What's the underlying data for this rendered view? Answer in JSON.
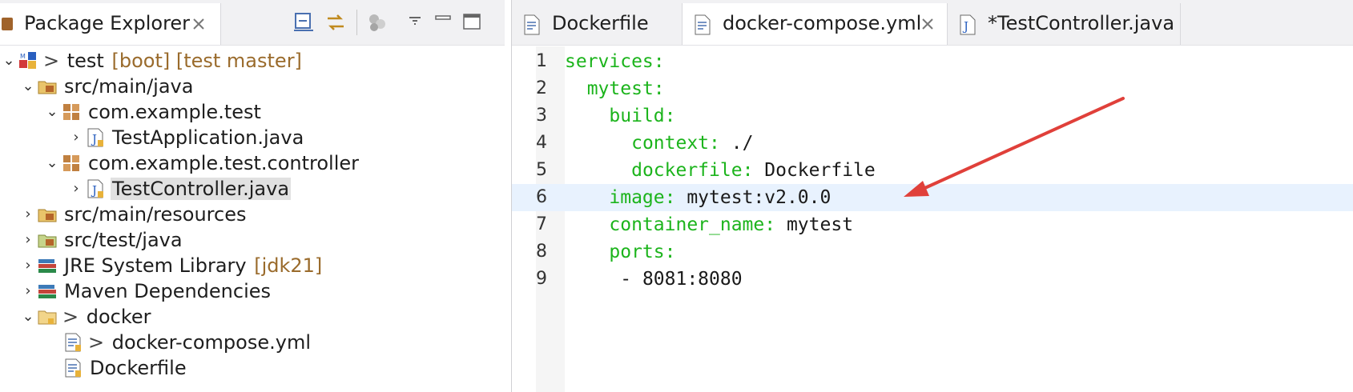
{
  "explorer": {
    "title": "Package Explorer",
    "tree": [
      {
        "name": "test-project",
        "expanded": true,
        "prefix": "> ",
        "label": "test",
        "suffix": " [boot] [test master]",
        "icon": "maven-project-icon",
        "indent": 0
      },
      {
        "name": "src-main-java",
        "expanded": true,
        "label": "src/main/java",
        "icon": "source-folder-icon",
        "indent": 1
      },
      {
        "name": "package-com-example-test",
        "expanded": true,
        "label": "com.example.test",
        "icon": "package-icon",
        "indent": 2
      },
      {
        "name": "file-testapplication",
        "expanded": false,
        "label": "TestApplication.java",
        "icon": "java-file-icon",
        "indent": 3
      },
      {
        "name": "package-com-example-test-controller",
        "expanded": true,
        "label": "com.example.test.controller",
        "icon": "package-icon",
        "indent": 2
      },
      {
        "name": "file-testcontroller",
        "expanded": false,
        "label": "TestController.java",
        "icon": "java-file-icon",
        "indent": 3,
        "selected": true
      },
      {
        "name": "src-main-resources",
        "expanded": false,
        "label": "src/main/resources",
        "icon": "source-folder-icon",
        "indent": 1
      },
      {
        "name": "src-test-java",
        "expanded": false,
        "label": "src/test/java",
        "icon": "test-folder-icon",
        "indent": 1
      },
      {
        "name": "jre-system-library",
        "expanded": false,
        "label": "JRE System Library",
        "suffix": " [jdk21]",
        "icon": "library-icon",
        "indent": 1
      },
      {
        "name": "maven-dependencies",
        "expanded": false,
        "label": "Maven Dependencies",
        "icon": "library-icon",
        "indent": 1
      },
      {
        "name": "folder-docker",
        "expanded": true,
        "prefix": "> ",
        "label": "docker",
        "icon": "folder-icon",
        "indent": 1
      },
      {
        "name": "file-docker-compose",
        "label": "docker-compose.yml",
        "prefix": "> ",
        "icon": "text-file-icon",
        "indent": 2
      },
      {
        "name": "file-dockerfile",
        "label": "Dockerfile",
        "icon": "text-file-icon",
        "indent": 2
      }
    ]
  },
  "editor": {
    "tabs": [
      {
        "label": "Dockerfile",
        "active": false,
        "closable": false
      },
      {
        "label": "docker-compose.yml",
        "active": true,
        "closable": true
      },
      {
        "label": "*TestController.java",
        "active": false,
        "closable": false
      }
    ],
    "lines": [
      {
        "n": "1",
        "indent": "",
        "key": "services:",
        "value": ""
      },
      {
        "n": "2",
        "indent": "  ",
        "key": "mytest:",
        "value": ""
      },
      {
        "n": "3",
        "indent": "    ",
        "key": "build:",
        "value": ""
      },
      {
        "n": "4",
        "indent": "      ",
        "key": "context:",
        "value": " ./"
      },
      {
        "n": "5",
        "indent": "      ",
        "key": "dockerfile:",
        "value": " Dockerfile"
      },
      {
        "n": "6",
        "indent": "    ",
        "key": "image:",
        "value": " mytest:v2.0.0",
        "current": true
      },
      {
        "n": "7",
        "indent": "    ",
        "key": "container_name:",
        "value": " mytest"
      },
      {
        "n": "8",
        "indent": "    ",
        "key": "ports:",
        "value": ""
      },
      {
        "n": "9",
        "indent": "     ",
        "key": "",
        "value": "- 8081:8080"
      }
    ]
  },
  "colors": {
    "accent_arrow": "#e0403a",
    "yaml_key": "#1cb41c",
    "current_line": "#e8f2fe"
  }
}
